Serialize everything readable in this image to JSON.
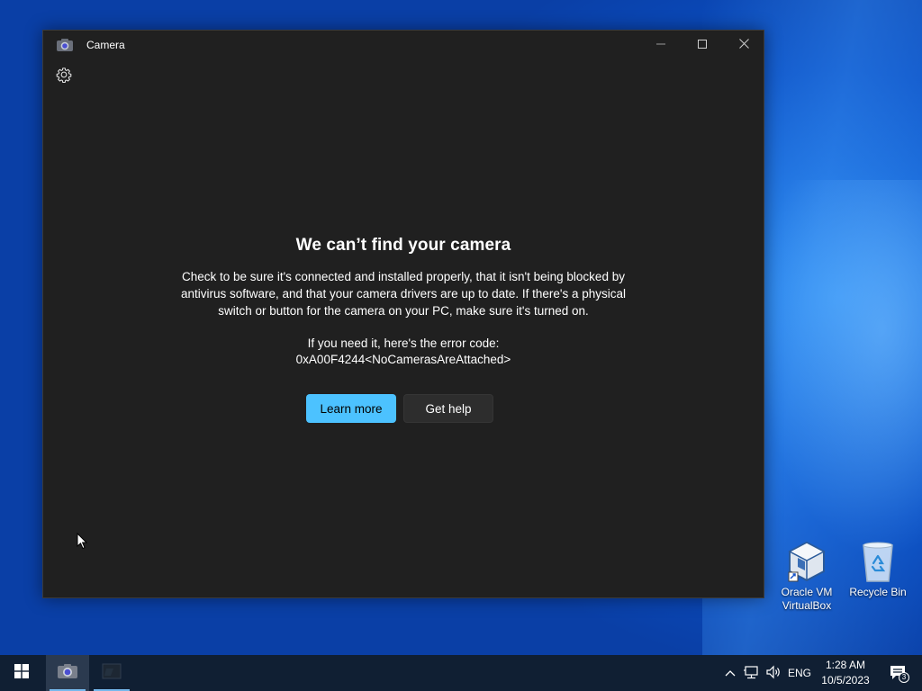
{
  "window": {
    "title": "Camera",
    "controls": {
      "minimize": "minimize-icon",
      "maximize": "maximize-icon",
      "close": "close-icon"
    },
    "settings_icon": "gear-icon"
  },
  "error": {
    "title": "We can’t find your camera",
    "body": "Check to be sure it's connected and installed properly, that it isn't being blocked by antivirus software, and that your camera drivers are up to date. If there's a physical switch or button for the camera on your PC, make sure it's turned on.",
    "code_label": "If you need it, here's the error code:",
    "code": "0xA00F4244<NoCamerasAreAttached>",
    "learn_more": "Learn more",
    "get_help": "Get help"
  },
  "desktop": {
    "icons": [
      {
        "label_line1": "Oracle VM",
        "label_line2": "VirtualBox",
        "icon": "virtualbox-icon"
      },
      {
        "label_line1": "Recycle Bin",
        "label_line2": "",
        "icon": "recycle-bin-icon"
      }
    ]
  },
  "taskbar": {
    "start_icon": "windows-start-icon",
    "apps": [
      {
        "name": "Camera",
        "icon": "camera-icon",
        "active": true
      },
      {
        "name": "Terminal",
        "icon": "terminal-icon",
        "active": false
      }
    ],
    "tray": {
      "chevron": "chevron-up-icon",
      "network": "network-icon",
      "volume": "volume-icon",
      "language": "ENG",
      "time": "1:28 AM",
      "date": "10/5/2023",
      "notifications_count": "3"
    }
  },
  "colors": {
    "accent": "#4cc2ff",
    "window_bg": "#202020",
    "taskbar_bg": "#101f33"
  }
}
